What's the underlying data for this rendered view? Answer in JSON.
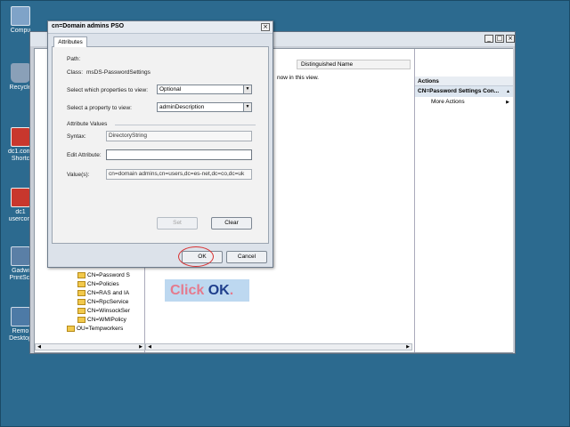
{
  "desktop": {
    "icons": [
      {
        "label": "Compu",
        "name": "computer-desktop-icon",
        "color": "#7fa3c8"
      },
      {
        "label": "Recycle",
        "name": "recycle-bin-icon",
        "color": "#8aa0b8"
      },
      {
        "label": "dc1.cons",
        "label2": "Shortc",
        "name": "console-shortcut-icon",
        "color": "#c8372d"
      },
      {
        "label": "dc1",
        "label2": "userconf",
        "name": "userconf-shortcut-icon",
        "color": "#c8372d"
      },
      {
        "label": "Gadwi",
        "label2": "PrintScr",
        "name": "printscreen-icon",
        "color": "#5a7fa6"
      },
      {
        "label": "Remo",
        "label2": "Desktop",
        "name": "remote-desktop-icon",
        "color": "#4d7aa6"
      }
    ]
  },
  "mmc": {
    "list_header": "Distinguished Name",
    "list_empty": "now in this view.",
    "tree_items": [
      "CN=Password S",
      "CN=Policies",
      "CN=RAS and IA",
      "CN=RpcService",
      "CN=WinsockSer",
      "CN=WMIPolicy",
      "OU=Tempworkers"
    ],
    "actions": {
      "header": "Actions",
      "selected": "CN=Password Settings Con...",
      "more": "More Actions"
    }
  },
  "dialog": {
    "title": "cn=Domain admins PSO",
    "tab": "Attributes",
    "path_label": "Path:",
    "class_label": "Class:",
    "class_value": "msDS-PasswordSettings",
    "select_view_label": "Select which properties to view:",
    "select_view_value": "Optional",
    "select_prop_label": "Select a property to view:",
    "select_prop_value": "adminDescription",
    "attr_values_label": "Attribute Values",
    "syntax_label": "Syntax:",
    "syntax_value": "DirectoryString",
    "edit_label": "Edit Attribute:",
    "edit_value": "",
    "values_label": "Value(s):",
    "values_value": "cn=domain admins,cn=users,dc=es-net,dc=co,dc=uk",
    "set_button": "Set",
    "clear_button": "Clear",
    "ok_button": "OK",
    "cancel_button": "Cancel"
  },
  "callout": {
    "word1": "Click",
    "word2": "OK",
    "word3": "."
  },
  "colors": {
    "desktop_bg": "#2c6a8f",
    "highlight_ring": "#d93232",
    "callout_bg": "#bdd8f0"
  }
}
